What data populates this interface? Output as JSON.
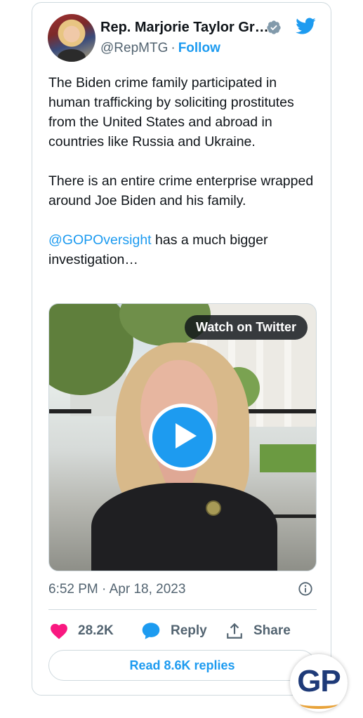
{
  "tweet": {
    "author_name": "Rep. Marjorie Taylor Gr…",
    "handle": "@RepMTG",
    "separator": "·",
    "follow_label": "Follow",
    "paragraphs": [
      "The Biden crime family participated in human trafficking by soliciting prostitutes from the United States and abroad in countries like Russia and Ukraine.",
      "There is an entire crime enterprise wrapped around Joe Biden and his family."
    ],
    "mention": "@GOPOversight",
    "mention_suffix": " has a much bigger investigation…",
    "watch_label": "Watch on Twitter",
    "timestamp": "6:52 PM · Apr 18, 2023",
    "likes": "28.2K",
    "reply_label": "Reply",
    "share_label": "Share",
    "read_replies_label": "Read 8.6K replies"
  },
  "watermark": {
    "text": "GP"
  },
  "colors": {
    "accent": "#1d9bf0",
    "like": "#f91880",
    "muted": "#536471",
    "border": "#cfd9de"
  },
  "icons": [
    "verified-badge-icon",
    "twitter-bird-icon",
    "play-icon",
    "info-icon",
    "heart-icon",
    "reply-bubble-icon",
    "share-icon"
  ]
}
